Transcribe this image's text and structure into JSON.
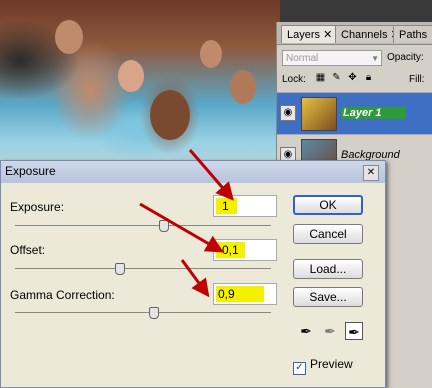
{
  "layers_panel": {
    "tabs": [
      "Layers",
      "Channels",
      "Paths"
    ],
    "blend_mode": "Normal",
    "opacity_label": "Opacity:",
    "lock_label": "Lock:",
    "fill_label": "Fill:",
    "layers": [
      {
        "name": "Layer 1",
        "selected": true
      },
      {
        "name": "Background",
        "selected": false
      }
    ]
  },
  "dialog": {
    "title": "Exposure",
    "close_glyph": "✕",
    "exposure": {
      "label": "Exposure:",
      "value": "1"
    },
    "offset": {
      "label": "Offset:",
      "value": "-0,1"
    },
    "gamma": {
      "label": "Gamma Correction:",
      "value": "0,9"
    },
    "buttons": {
      "ok": "OK",
      "cancel": "Cancel",
      "load": "Load...",
      "save": "Save..."
    },
    "preview": {
      "label": "Preview",
      "checked": true
    }
  },
  "colors": {
    "highlight": "#f4f000",
    "annotation_arrow": "#c00000",
    "selection": "#3f6fc4",
    "layer_label": "#2e9a3a"
  }
}
